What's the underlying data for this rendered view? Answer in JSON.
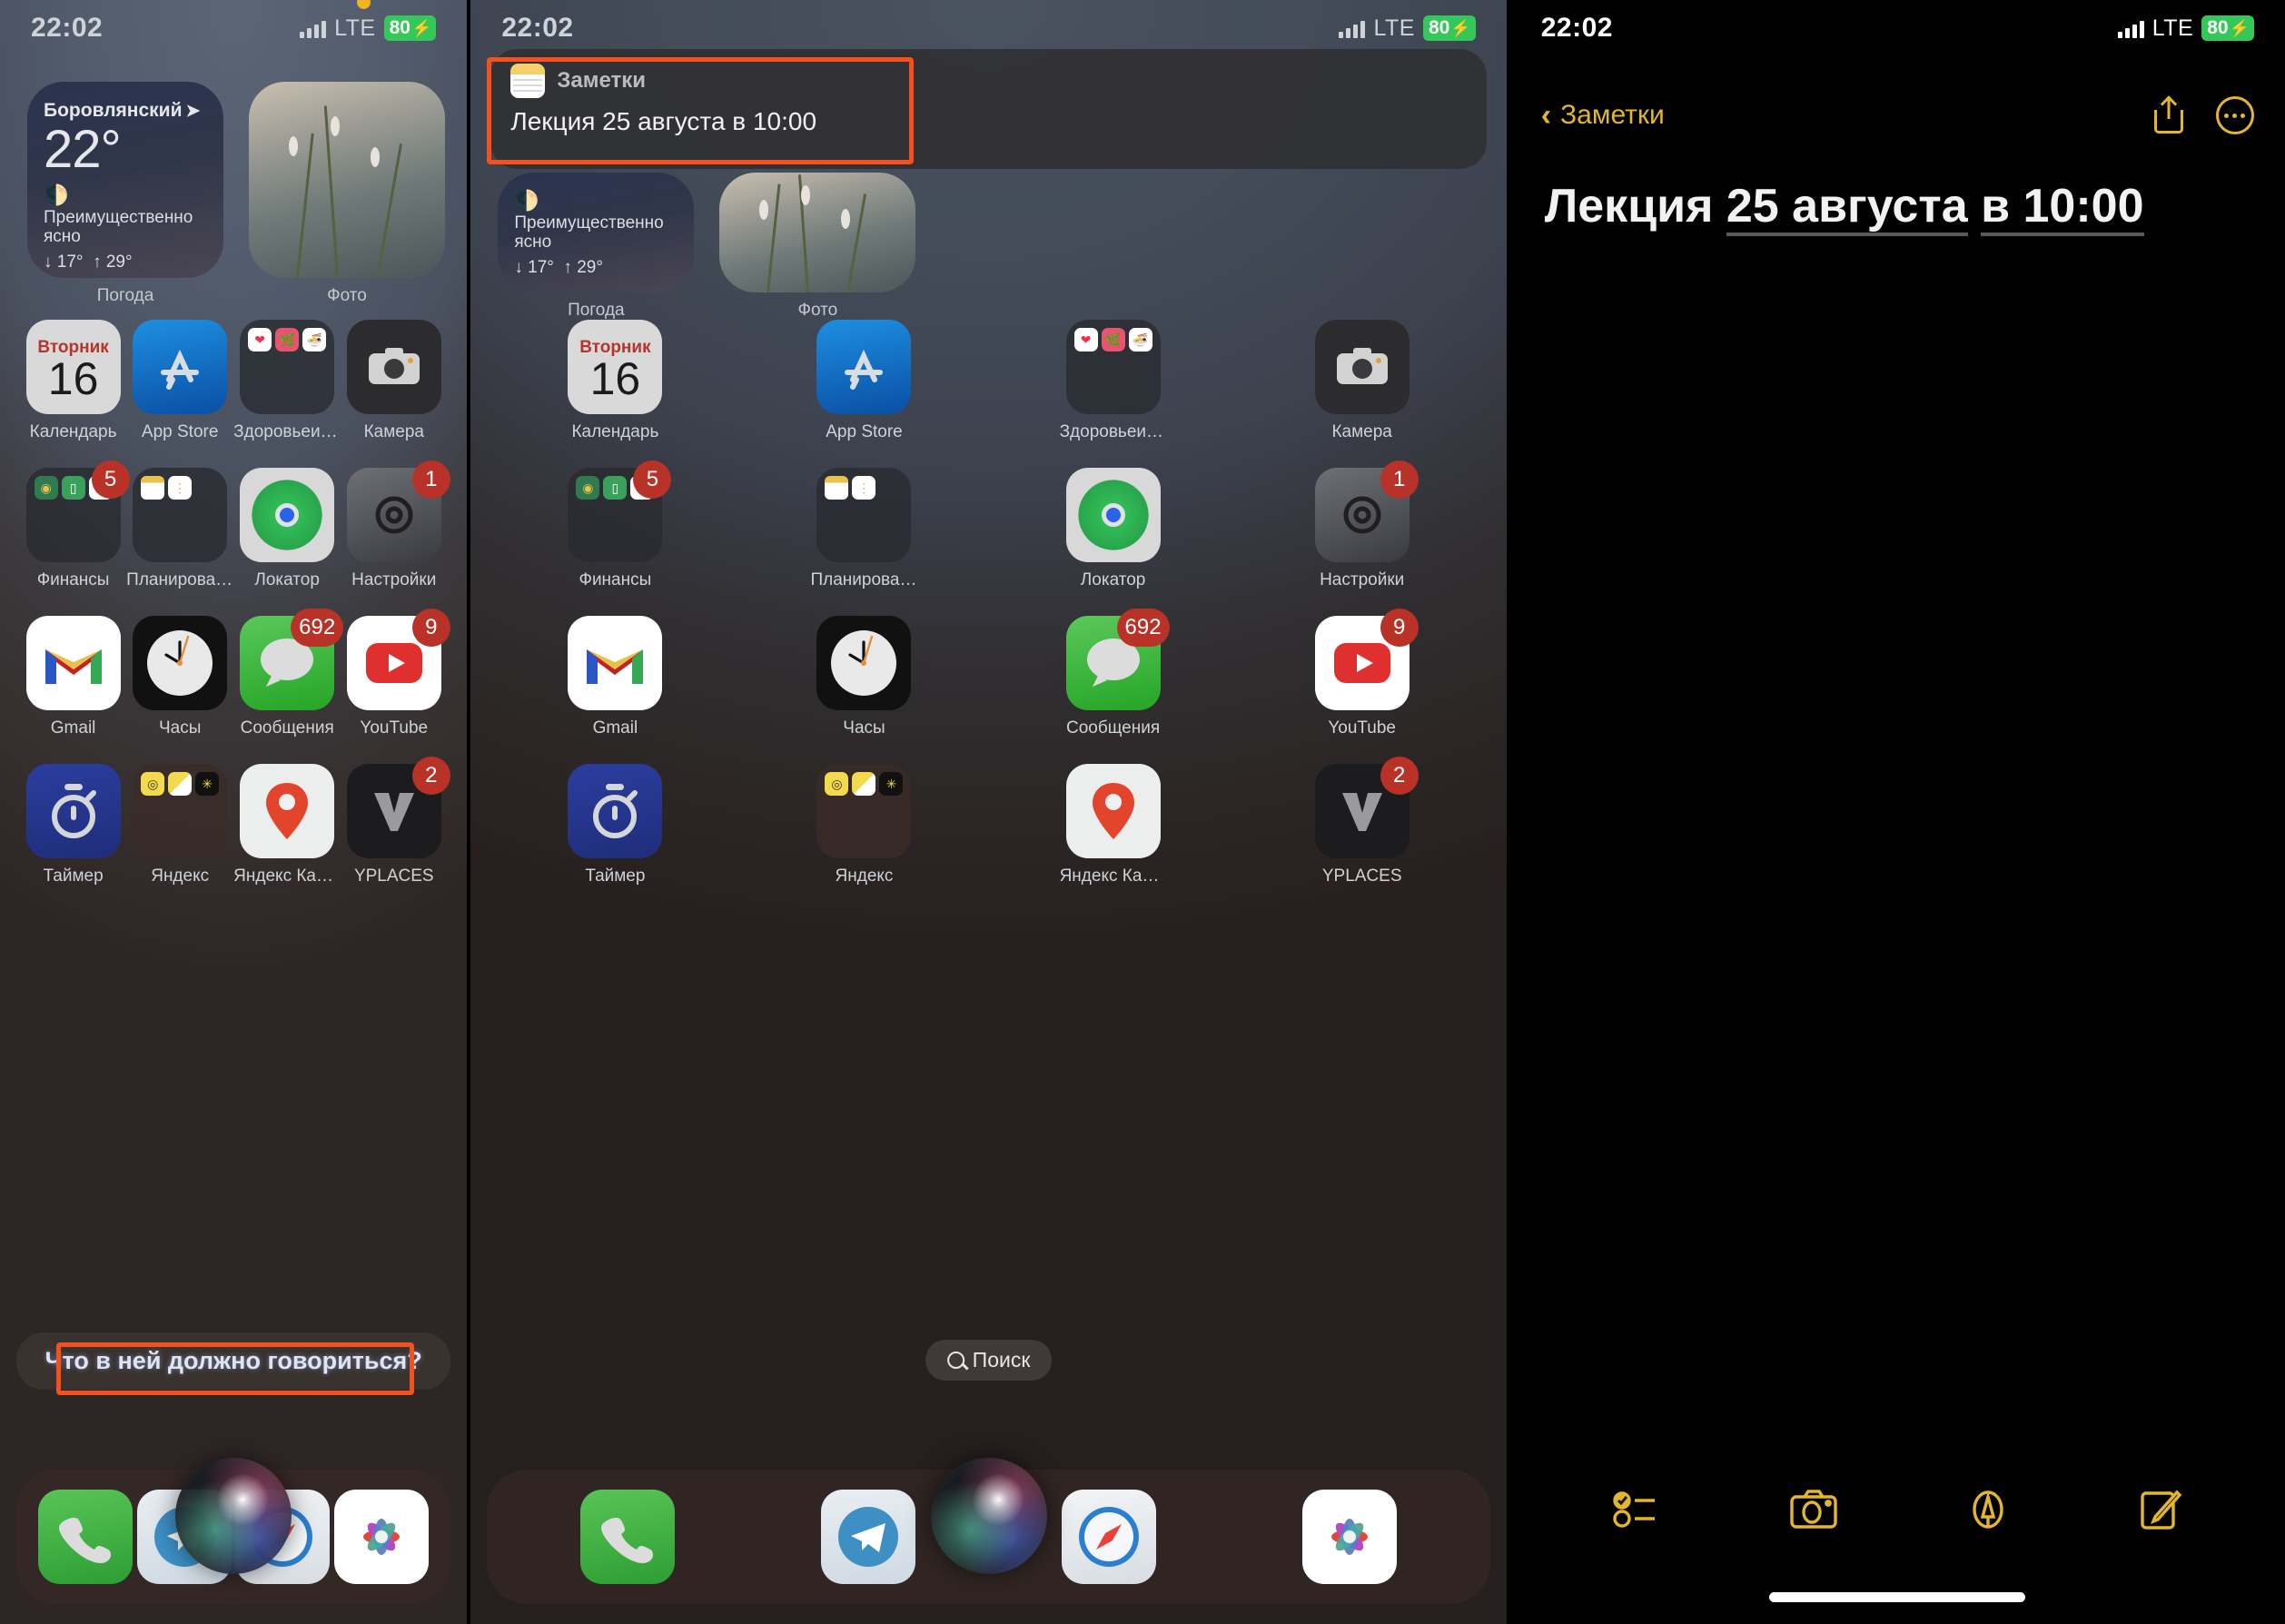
{
  "status_bar": {
    "time": "22:02",
    "network": "LTE",
    "battery": "80",
    "battery_charging_glyph": "⚡",
    "mic_indicator_color": "#f0b323",
    "battery_color": "#34c759"
  },
  "highlight_color": "#f4511e",
  "weather_widget": {
    "city": "Боровлянский",
    "location_arrow": "➤",
    "temperature": "22°",
    "condition_icon": "moon-stars-icon",
    "condition": "Преимущественно ясно",
    "low": "↓ 17°",
    "high": "↑ 29°",
    "label": "Погода"
  },
  "photo_widget": {
    "label": "Фото"
  },
  "apps": [
    {
      "name": "Календарь",
      "icon": "calendar-icon",
      "badge": "",
      "cal_dow": "Вторник",
      "cal_day": "16"
    },
    {
      "name": "App Store",
      "icon": "appstore-icon",
      "badge": ""
    },
    {
      "name": "Здоровьеифит...",
      "icon": "folder-icon",
      "badge": ""
    },
    {
      "name": "Камера",
      "icon": "camera-icon",
      "badge": ""
    },
    {
      "name": "Финансы",
      "icon": "folder-icon",
      "badge": "5"
    },
    {
      "name": "Планирование",
      "icon": "folder-icon",
      "badge": ""
    },
    {
      "name": "Локатор",
      "icon": "findmy-icon",
      "badge": ""
    },
    {
      "name": "Настройки",
      "icon": "settings-icon",
      "badge": "1"
    },
    {
      "name": "Gmail",
      "icon": "gmail-icon",
      "badge": ""
    },
    {
      "name": "Часы",
      "icon": "clock-icon",
      "badge": ""
    },
    {
      "name": "Сообщения",
      "icon": "messages-icon",
      "badge": "692"
    },
    {
      "name": "YouTube",
      "icon": "youtube-icon",
      "badge": "9"
    },
    {
      "name": "Таймер",
      "icon": "timer-icon",
      "badge": ""
    },
    {
      "name": "Яндекс",
      "icon": "folder-icon",
      "badge": ""
    },
    {
      "name": "Яндекс Карты",
      "icon": "yandex-maps-icon",
      "badge": ""
    },
    {
      "name": "YPLACES",
      "icon": "yplaces-icon",
      "badge": "2"
    }
  ],
  "dock": [
    {
      "name": "Телефон",
      "icon": "phone-icon"
    },
    {
      "name": "Telegram",
      "icon": "telegram-icon"
    },
    {
      "name": "Safari",
      "icon": "safari-icon"
    },
    {
      "name": "Фото",
      "icon": "photos-icon"
    }
  ],
  "siri": {
    "prompt": "Что в ней должно говориться?",
    "orb": "siri-orb"
  },
  "search": {
    "label": "Поиск",
    "icon": "search-icon"
  },
  "notification": {
    "app": "Заметки",
    "app_icon": "notes-icon",
    "body": "Лекция 25 августа в 10:00"
  },
  "notes_app": {
    "back_label": "Заметки",
    "back_icon": "chevron-left-icon",
    "share_icon": "share-icon",
    "more_icon": "more-ellipsis-icon",
    "accent_color": "#e2b631",
    "title_plain": "Лекция ",
    "title_link_date": "25 августа",
    "title_link_time": "в 10:00",
    "toolbar": [
      {
        "name": "Чеклист",
        "icon": "checklist-icon"
      },
      {
        "name": "Камера",
        "icon": "camera-icon"
      },
      {
        "name": "Разметка",
        "icon": "markup-pen-icon"
      },
      {
        "name": "Новая заметка",
        "icon": "compose-icon"
      }
    ]
  }
}
